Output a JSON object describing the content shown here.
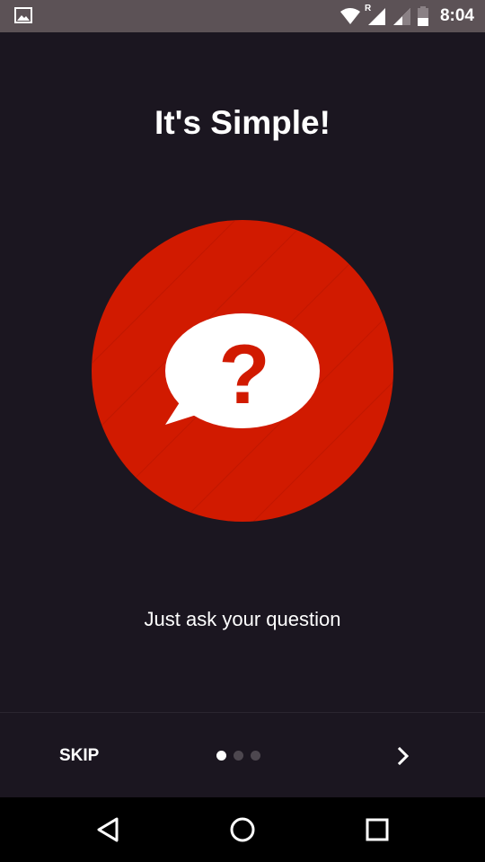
{
  "status_bar": {
    "time": "8:04",
    "icons": [
      "gallery-icon",
      "wifi-icon",
      "signal-roaming-icon",
      "signal-icon",
      "battery-icon"
    ],
    "roaming_label": "R"
  },
  "onboarding": {
    "title": "It's Simple!",
    "subtitle": "Just ask your question",
    "hero_icon": "question-chat-bubble-icon",
    "hero_glyph": "?",
    "page_indicator": {
      "current": 1,
      "total": 3
    },
    "skip_label": "SKIP",
    "next_icon": "chevron-right-icon"
  },
  "nav_bar": {
    "buttons": [
      "back-triangle-icon",
      "home-circle-icon",
      "recents-square-icon"
    ]
  },
  "colors": {
    "background": "#1b1620",
    "accent_red": "#d11a00",
    "status_bar": "#5c5256",
    "nav_bar": "#000000",
    "text": "#ffffff",
    "dot_inactive": "#4d474f"
  }
}
